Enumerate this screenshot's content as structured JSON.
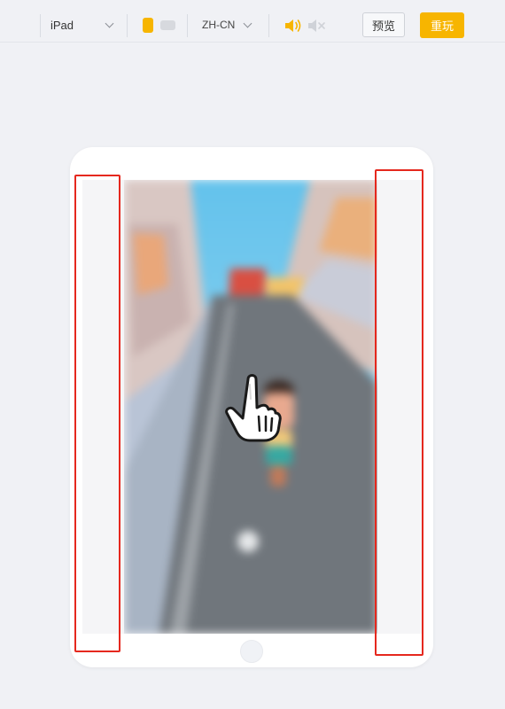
{
  "toolbar": {
    "device_label": "iPad",
    "language_label": "ZH-CN",
    "preview_label": "预览",
    "replay_label": "重玩",
    "accent_color": "#f7b500",
    "icons": {
      "device_dropdown": "chevron-down-icon",
      "language_dropdown": "chevron-down-icon",
      "portrait": "portrait-orientation-icon",
      "landscape": "landscape-orientation-icon",
      "sound_on": "speaker-on-icon",
      "sound_off": "speaker-mute-icon"
    },
    "selected_orientation": "portrait",
    "sound_enabled": true
  },
  "device_frame": {
    "model": "iPad",
    "home_button_icon": "home-button"
  },
  "game_preview": {
    "description_icon": "tap-hand-icon",
    "blurred": true
  },
  "annotations": {
    "highlight_color": "#e5281e"
  }
}
